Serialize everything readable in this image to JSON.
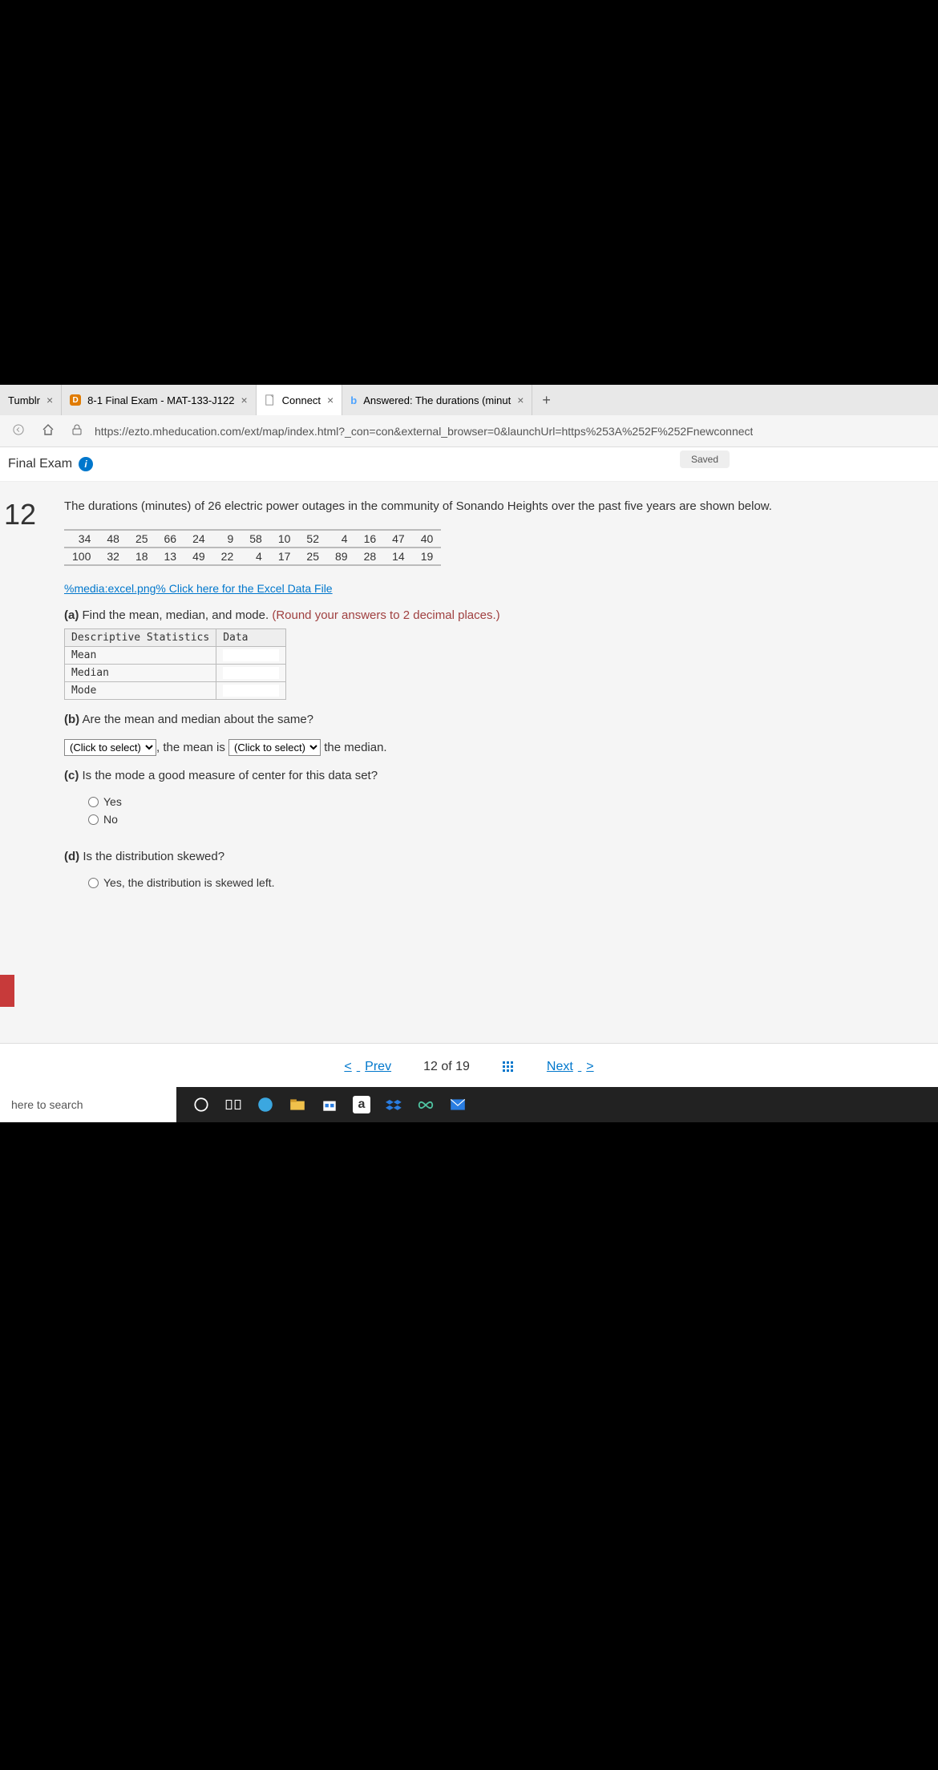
{
  "tabs": [
    {
      "label": "Tumblr"
    },
    {
      "label": "8-1 Final Exam - MAT-133-J122"
    },
    {
      "label": "Connect"
    },
    {
      "label": "Answered: The durations (minut"
    }
  ],
  "url": "https://ezto.mheducation.com/ext/map/index.html?_con=con&external_browser=0&launchUrl=https%253A%252F%252Fnewconnect",
  "exam_title": "Final Exam",
  "saved": "Saved",
  "question_number": "12",
  "intro": "The durations (minutes) of 26 electric power outages in the community of Sonando Heights over the past five years are shown below.",
  "data_rows": [
    [
      "34",
      "48",
      "25",
      "66",
      "24",
      "9",
      "58",
      "10",
      "52",
      "4",
      "16",
      "47",
      "40"
    ],
    [
      "100",
      "32",
      "18",
      "13",
      "49",
      "22",
      "4",
      "17",
      "25",
      "89",
      "28",
      "14",
      "19"
    ]
  ],
  "excel_link": "%media:excel.png% Click here for the Excel Data File",
  "part_a": {
    "label": "(a)",
    "text": " Find the mean, median, and mode. ",
    "hint": "(Round your answers to 2 decimal places.)"
  },
  "stats": {
    "h1": "Descriptive Statistics",
    "h2": "Data",
    "rows": [
      "Mean",
      "Median",
      "Mode"
    ]
  },
  "part_b": {
    "label": "(b)",
    "text": " Are the mean and median about the same?"
  },
  "sentence": {
    "pre": ", the mean is ",
    "post": " the median.",
    "sel": "(Click to select)"
  },
  "part_c": {
    "label": "(c)",
    "text": " Is the mode a good measure of center for this data set?"
  },
  "yes": "Yes",
  "no": "No",
  "part_d": {
    "label": "(d)",
    "text": " Is the distribution skewed?"
  },
  "skew_opt": "Yes, the distribution is skewed left.",
  "paging": {
    "prev": "Prev",
    "count": "12 of 19",
    "next": "Next"
  },
  "taskbar_search": "here to search"
}
